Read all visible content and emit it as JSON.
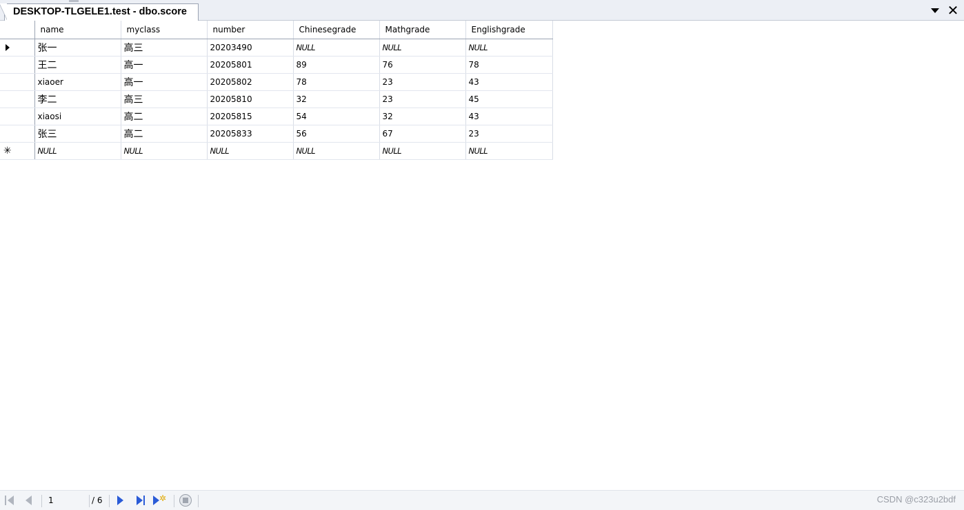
{
  "tab": {
    "title": "DESKTOP-TLGELE1.test - dbo.score",
    "dropdown_icon": "chevron-down-icon",
    "close_icon": "close-icon",
    "close_glyph": "✕"
  },
  "grid": {
    "columns": [
      "name",
      "myclass",
      "number",
      "Chinesegrade",
      "Mathgrade",
      "Englishgrade"
    ],
    "rows": [
      {
        "selector": "current",
        "cells": [
          "张一",
          "高三",
          "20203490",
          "NULL",
          "NULL",
          "NULL"
        ]
      },
      {
        "selector": "",
        "cells": [
          "王二",
          "高一",
          "20205801",
          "89",
          "76",
          "78"
        ]
      },
      {
        "selector": "",
        "cells": [
          "xiaoer",
          "高一",
          "20205802",
          "78",
          "23",
          "43"
        ]
      },
      {
        "selector": "",
        "cells": [
          "李二",
          "高三",
          "20205810",
          "32",
          "23",
          "45"
        ]
      },
      {
        "selector": "",
        "cells": [
          "xiaosi",
          "高二",
          "20205815",
          "54",
          "32",
          "43"
        ]
      },
      {
        "selector": "",
        "cells": [
          "张三",
          "高二",
          "20205833",
          "56",
          "67",
          "23"
        ]
      }
    ],
    "new_row": {
      "selector_glyph": "✳",
      "cells": [
        "NULL",
        "NULL",
        "NULL",
        "NULL",
        "NULL",
        "NULL"
      ]
    }
  },
  "navbar": {
    "current_page": "1",
    "total_pages": "/ 6",
    "icons": [
      "first-record-icon",
      "previous-record-icon",
      "next-record-icon",
      "last-record-icon",
      "new-record-icon",
      "stop-icon"
    ]
  },
  "watermark": "CSDN @c323u2bdf",
  "colors": {
    "accent": "#2a5bd7",
    "tab_border": "#9aa3b2",
    "null_text": "#000000"
  }
}
